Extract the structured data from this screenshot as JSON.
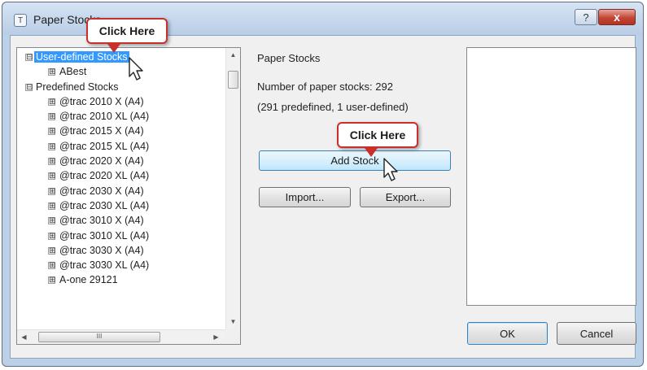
{
  "window": {
    "title": "Paper Stocks",
    "icon": "app-icon",
    "help_label": "?",
    "close_label": "x"
  },
  "tree": {
    "items": [
      {
        "label": "User-defined Stocks",
        "expander": "⊟",
        "level": 0,
        "selected": true
      },
      {
        "label": "ABest",
        "expander": "⊞",
        "level": 1
      },
      {
        "label": "Predefined Stocks",
        "expander": "⊟",
        "level": 0
      },
      {
        "label": "@trac 2010 X (A4)",
        "expander": "⊞",
        "level": 1
      },
      {
        "label": "@trac 2010 XL (A4)",
        "expander": "⊞",
        "level": 1
      },
      {
        "label": "@trac 2015 X (A4)",
        "expander": "⊞",
        "level": 1
      },
      {
        "label": "@trac 2015 XL (A4)",
        "expander": "⊞",
        "level": 1
      },
      {
        "label": "@trac 2020 X (A4)",
        "expander": "⊞",
        "level": 1
      },
      {
        "label": "@trac 2020 XL (A4)",
        "expander": "⊞",
        "level": 1
      },
      {
        "label": "@trac 2030 X (A4)",
        "expander": "⊞",
        "level": 1
      },
      {
        "label": "@trac 2030 XL (A4)",
        "expander": "⊞",
        "level": 1
      },
      {
        "label": "@trac 3010 X (A4)",
        "expander": "⊞",
        "level": 1
      },
      {
        "label": "@trac 3010 XL (A4)",
        "expander": "⊞",
        "level": 1
      },
      {
        "label": "@trac 3030 X (A4)",
        "expander": "⊞",
        "level": 1
      },
      {
        "label": "@trac 3030 XL (A4)",
        "expander": "⊞",
        "level": 1
      },
      {
        "label": "A-one 29121",
        "expander": "⊞",
        "level": 1
      }
    ],
    "hscroll_grip": "III"
  },
  "panel": {
    "group_label": "Paper Stocks",
    "count_text": "Number of paper stocks: 292",
    "breakdown_text": "(291 predefined, 1 user-defined)",
    "add_stock_label": "Add Stock",
    "import_label": "Import...",
    "export_label": "Export..."
  },
  "footer": {
    "ok_label": "OK",
    "cancel_label": "Cancel"
  },
  "callouts": {
    "top_label": "Click Here",
    "mid_label": "Click Here"
  },
  "colors": {
    "selection": "#3399ff",
    "callout_border": "#c9302c",
    "close_button": "#c24634"
  }
}
